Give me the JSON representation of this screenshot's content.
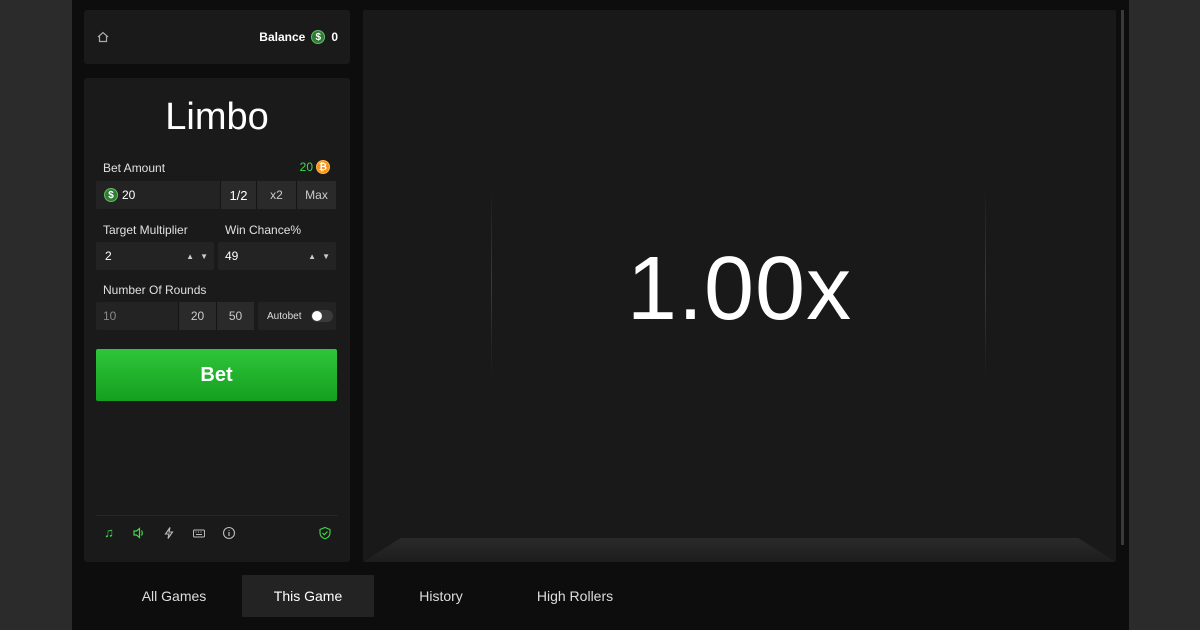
{
  "header": {
    "balance_label": "Balance",
    "balance_value": "0",
    "currency_symbol": "$"
  },
  "game": {
    "title": "Limbo",
    "multiplier_display": "1.00x"
  },
  "bet": {
    "label": "Bet Amount",
    "max_amount": "20",
    "amount_value": "20",
    "half_label": "1/2",
    "double_label": "x2",
    "max_label": "Max",
    "button_label": "Bet"
  },
  "target": {
    "label": "Target Multiplier",
    "value": "2"
  },
  "win_chance": {
    "label": "Win Chance%",
    "value": "49"
  },
  "rounds": {
    "label": "Number Of Rounds",
    "value": "10",
    "preset_1": "20",
    "preset_2": "50",
    "autobet_label": "Autobet",
    "autobet_enabled": false
  },
  "tabs": [
    {
      "label": "All Games",
      "active": false
    },
    {
      "label": "This Game",
      "active": true
    },
    {
      "label": "History",
      "active": false
    },
    {
      "label": "High Rollers",
      "active": false
    }
  ],
  "colors": {
    "accent_green": "#1fb52b",
    "bitcoin_orange": "#f7931a",
    "bg_dark": "#0d0d0d",
    "panel": "#1a1a1a"
  },
  "icons": [
    "home-icon",
    "dollar-coin-icon",
    "bitcoin-icon",
    "music-icon",
    "volume-icon",
    "lightning-icon",
    "keyboard-icon",
    "info-icon",
    "shield-check-icon"
  ]
}
